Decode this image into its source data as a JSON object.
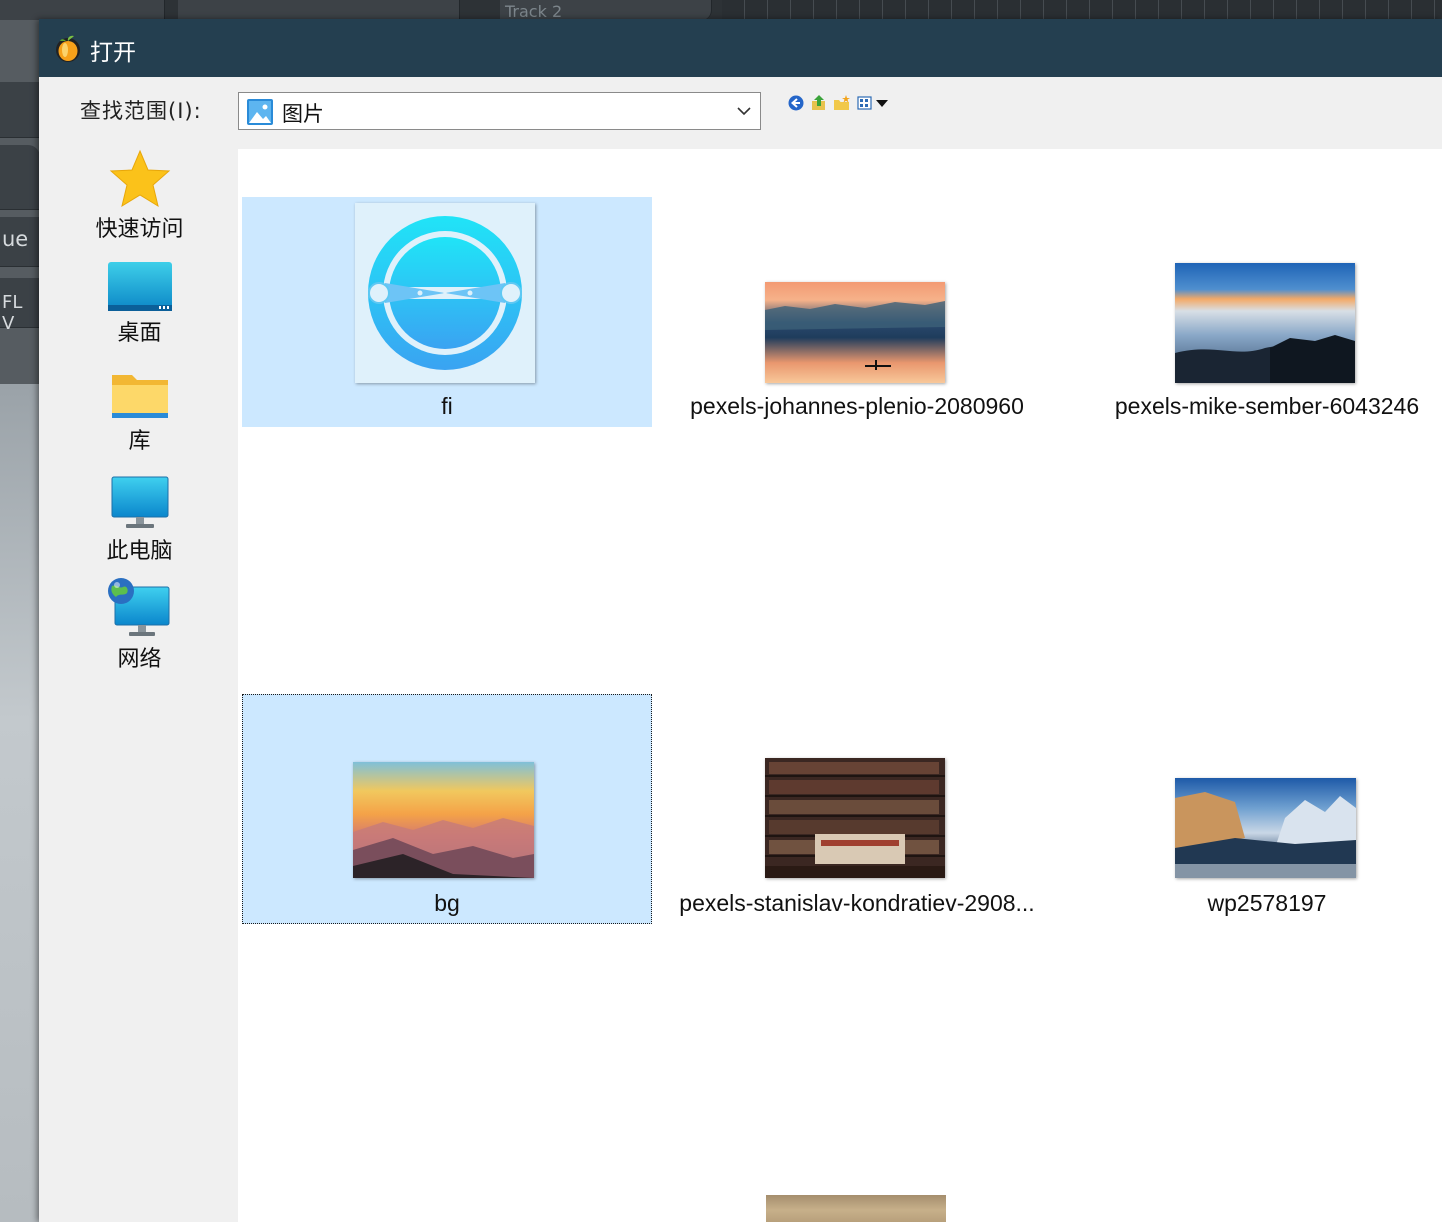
{
  "background_app": {
    "track_label": "Track 2",
    "left_strip_texts": [
      "ue",
      "FL V"
    ]
  },
  "dialog": {
    "title": "打开",
    "lookin_label": "查找范围(I):",
    "lookin_value": "图片",
    "toolbar": [
      "back-icon",
      "up-folder-icon",
      "new-folder-icon",
      "view-menu-icon"
    ]
  },
  "places": [
    {
      "label": "快速访问",
      "icon": "star-icon"
    },
    {
      "label": "桌面",
      "icon": "desktop-icon"
    },
    {
      "label": "库",
      "icon": "folder-icon"
    },
    {
      "label": "此电脑",
      "icon": "computer-icon"
    },
    {
      "label": "网络",
      "icon": "network-icon"
    }
  ],
  "files": [
    {
      "name": "fi",
      "state": "selected"
    },
    {
      "name": "pexels-johannes-plenio-2080960",
      "state": "normal"
    },
    {
      "name": "pexels-mike-sember-6043246",
      "state": "normal"
    },
    {
      "name": "bg",
      "state": "focused"
    },
    {
      "name": "pexels-stanislav-kondratiev-2908...",
      "state": "normal"
    },
    {
      "name": "wp2578197",
      "state": "normal"
    }
  ],
  "colors": {
    "titlebar": "#243f50",
    "selection": "#cce8ff",
    "accent": "#1aa6e8"
  }
}
